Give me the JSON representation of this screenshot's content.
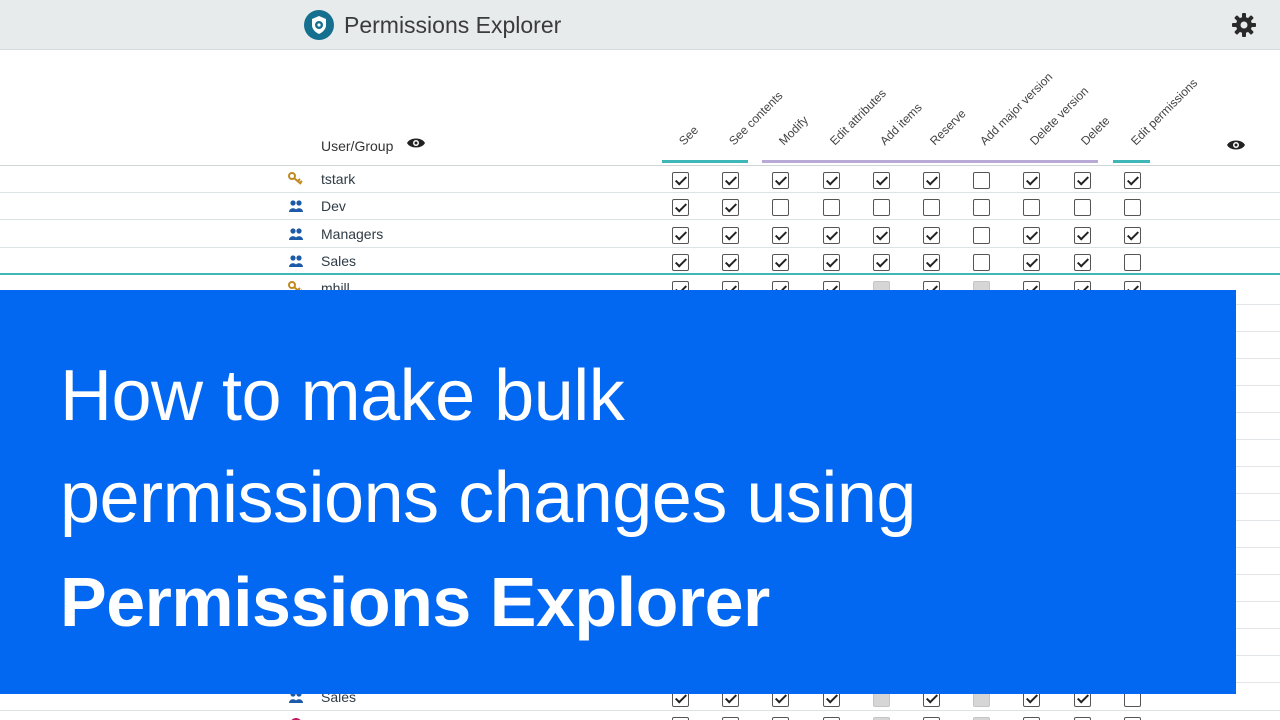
{
  "header": {
    "title": "Permissions Explorer",
    "logo_icon": "shield-gear-icon",
    "settings_icon": "gear-icon"
  },
  "table": {
    "user_group_label": "User/Group",
    "columns": [
      "See",
      "See contents",
      "Modify",
      "Edit attributes",
      "Add items",
      "Reserve",
      "Add major version",
      "Delete version",
      "Delete",
      "Edit permissions"
    ],
    "rows": [
      {
        "name": "tstark",
        "icon": "key-icon",
        "perms": [
          1,
          1,
          1,
          1,
          1,
          1,
          0,
          1,
          1,
          1
        ]
      },
      {
        "name": "Dev",
        "icon": "group-icon",
        "perms": [
          1,
          1,
          0,
          0,
          0,
          0,
          0,
          0,
          0,
          0
        ]
      },
      {
        "name": "Managers",
        "icon": "group-icon",
        "perms": [
          1,
          1,
          1,
          1,
          1,
          1,
          0,
          1,
          1,
          1
        ]
      },
      {
        "name": "Sales",
        "icon": "group-icon",
        "perms": [
          1,
          1,
          1,
          1,
          1,
          1,
          0,
          1,
          1,
          0
        ]
      },
      {
        "name": "mhill",
        "icon": "key-icon",
        "perms": [
          1,
          1,
          1,
          1,
          2,
          1,
          2,
          1,
          1,
          1
        ]
      }
    ],
    "lower_rows": [
      {
        "name": "Sales",
        "icon": "group-icon",
        "perms": [
          1,
          1,
          1,
          1,
          2,
          1,
          2,
          1,
          1,
          0
        ]
      },
      {
        "name": "",
        "icon": "user-icon",
        "perms": [
          0,
          0,
          0,
          0,
          2,
          0,
          2,
          0,
          0,
          0
        ]
      }
    ]
  },
  "banner": {
    "line1": "How to make bulk",
    "line2": "permissions changes using",
    "line3": "Permissions Explorer"
  },
  "colors": {
    "banner": "#0368f1",
    "teal_accent": "#3fb6b8",
    "purple_accent": "#b9a9d6",
    "logo": "#15708f"
  }
}
